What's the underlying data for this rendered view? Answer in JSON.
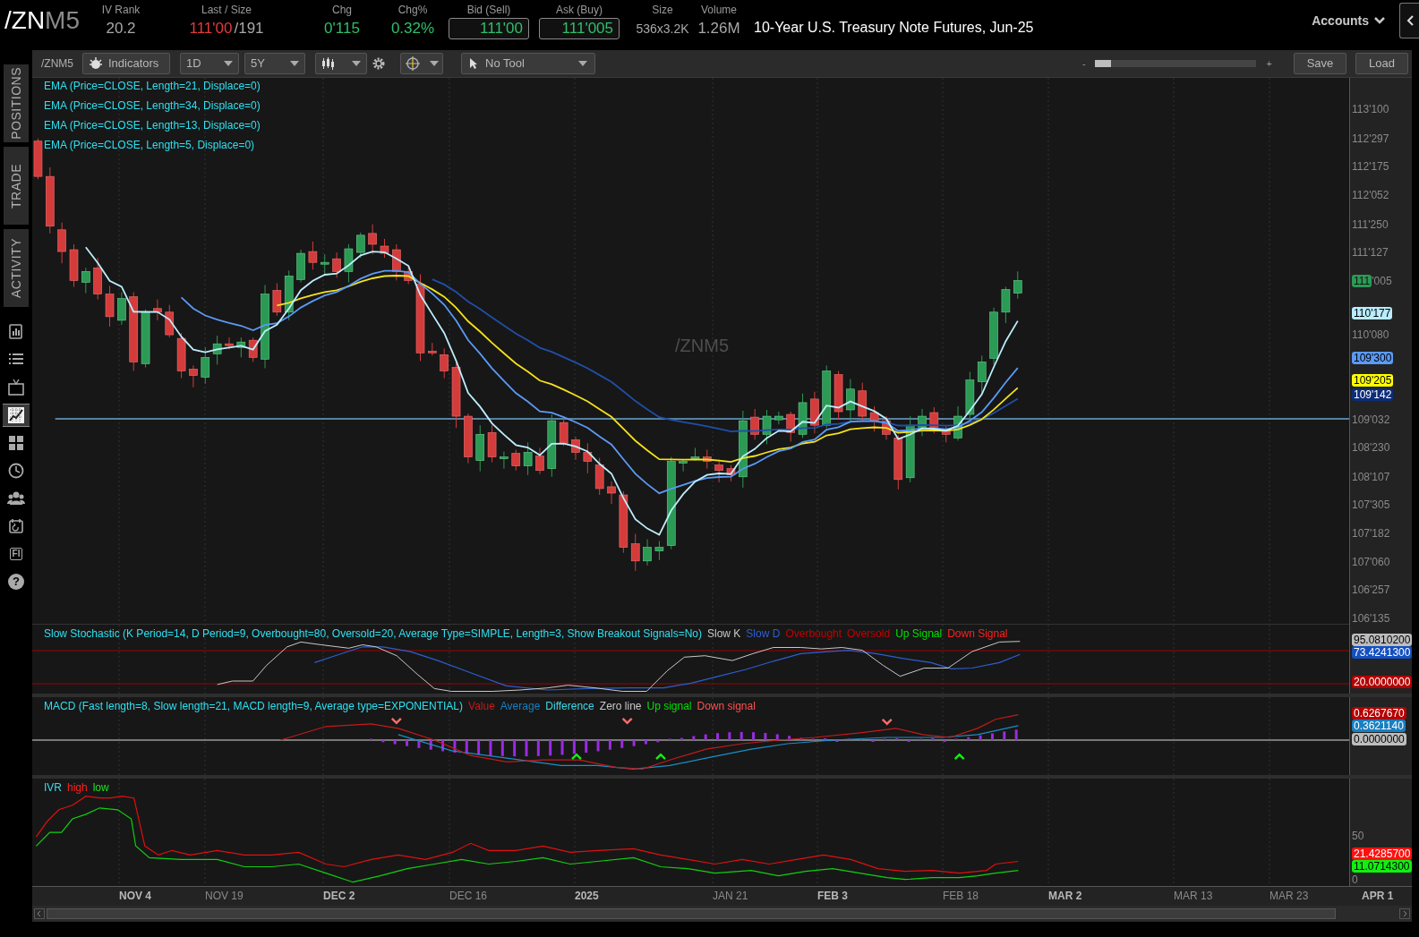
{
  "header": {
    "symbol_root": "/ZN",
    "symbol_suffix": "M5",
    "quotes": [
      {
        "kind": "plain",
        "label": "IV Rank",
        "value": "20.2"
      },
      {
        "kind": "plain",
        "label": "Last / Size",
        "value": "111'00",
        "rising": false,
        "extra": "/191"
      },
      {
        "kind": "plain",
        "label": "Chg",
        "value": "0'115",
        "rising": true
      },
      {
        "kind": "plain",
        "label": "Chg%",
        "value": "0.32%",
        "rising": true
      },
      {
        "kind": "boxed",
        "label": "Bid (Sell)",
        "value": "111'00",
        "rising": true
      },
      {
        "kind": "boxed",
        "label": "Ask (Buy)",
        "value": "111'005",
        "rising": true
      },
      {
        "kind": "small",
        "label": "Size",
        "value": "536x3.2K"
      },
      {
        "kind": "plain",
        "label": "Volume",
        "value": "1.26M"
      }
    ],
    "description": "10-Year U.S. Treasury Note Futures, Jun-25",
    "accounts": "Accounts"
  },
  "sidebar": {
    "tabs": [
      "POSITIONS",
      "TRADE",
      "ACTIVITY"
    ],
    "icons": [
      {
        "kind": "chart-book",
        "selected": false
      },
      {
        "kind": "list",
        "selected": false
      },
      {
        "kind": "tv",
        "selected": false
      },
      {
        "kind": "chart",
        "selected": true
      },
      {
        "kind": "tiles",
        "selected": false
      },
      {
        "kind": "clock",
        "selected": false
      },
      {
        "kind": "people",
        "selected": false
      },
      {
        "kind": "calendar",
        "selected": false
      },
      {
        "kind": "text",
        "label": "FI",
        "selected": false
      },
      {
        "kind": "help",
        "label": "?",
        "selected": false
      }
    ]
  },
  "toolbar": {
    "symbol": "/ZNM5",
    "indicators": "Indicators",
    "dropdowns": [
      "1D",
      "5Y"
    ],
    "drawing_tool": "No Tool",
    "zoom": {
      "minus": "-",
      "plus": "+",
      "level": 0.1
    },
    "buttons": [
      "Save",
      "Load"
    ]
  },
  "price_pane": {
    "studies": [
      "EMA (Price=CLOSE, Length=21, Displace=0)",
      "EMA (Price=CLOSE, Length=34, Displace=0)",
      "EMA (Price=CLOSE, Length=13, Displace=0)",
      "EMA (Price=CLOSE, Length=5, Displace=0)"
    ],
    "watermark": "/ZNM5",
    "ticks": [
      "113'100",
      "112'297",
      "112'175",
      "112'052",
      "111'250",
      "111'127",
      "110'080",
      "109'032",
      "108'230",
      "108'107",
      "107'305",
      "107'182",
      "107'060",
      "106'257",
      "106'135"
    ],
    "last_price": {
      "badge": "111",
      "tick": "'005",
      "color": "#2a9a55"
    },
    "markers": [
      {
        "text": "110'177",
        "color": "#b8ecff"
      },
      {
        "text": "109'300",
        "color": "#5b9af5"
      },
      {
        "text": "109'205",
        "color": "#ffff00"
      },
      {
        "text": "109'142",
        "color": "#0c2d78"
      }
    ]
  },
  "stochastic": {
    "title": "Slow Stochastic (K Period=14, D Period=9, Overbought=80, Oversold=20, Average Type=SIMPLE, Length=3, Show Breakout Signals=No)",
    "legend": [
      {
        "label": "Slow K",
        "color": "#c8c8c8"
      },
      {
        "label": "Slow D",
        "color": "#2c5fd0"
      },
      {
        "label": "Overbought",
        "color": "#c40000"
      },
      {
        "label": "Oversold",
        "color": "#c40000"
      },
      {
        "label": "Up Signal",
        "color": "#00e000"
      },
      {
        "label": "Down Signal",
        "color": "#ff2020"
      }
    ],
    "badges": [
      {
        "text": "95.0810200",
        "color": "#bdbdbd"
      },
      {
        "text": "73.4241300",
        "color": "#1450c0"
      },
      {
        "text": "20.0000000",
        "color": "#b40000"
      }
    ]
  },
  "macd": {
    "title": "MACD (Fast length=8, Slow length=21, MACD length=9, Average type=EXPONENTIAL)",
    "legend": [
      {
        "label": "Value",
        "color": "#c41a1a"
      },
      {
        "label": "Average",
        "color": "#1a7fc0"
      },
      {
        "label": "Difference",
        "color": "#40d8e8"
      },
      {
        "label": "Zero line",
        "color": "#c8c8c8"
      },
      {
        "label": "Up signal",
        "color": "#00e000"
      },
      {
        "label": "Down signal",
        "color": "#ff5050"
      }
    ],
    "badges": [
      {
        "text": "0.6267670",
        "color": "#b40000"
      },
      {
        "text": "0.3621140",
        "color": "#1a7fc0"
      },
      {
        "text": "0.0000000",
        "color": "#bdbdbd"
      }
    ]
  },
  "ivr": {
    "legend": [
      {
        "label": "IVR",
        "color": "#40d8e8"
      },
      {
        "label": "high",
        "color": "#ff2020"
      },
      {
        "label": "low",
        "color": "#20e020"
      }
    ],
    "ticks": [
      "50",
      "0"
    ],
    "badges": [
      {
        "text": "21.4285700",
        "color": "#ff1010"
      },
      {
        "text": "11.0714300",
        "color": "#10f010"
      }
    ]
  },
  "date_axis": [
    {
      "label": "NOV 4",
      "major": true
    },
    {
      "label": "NOV 19",
      "major": false
    },
    {
      "label": "DEC 2",
      "major": true
    },
    {
      "label": "DEC 16",
      "major": false
    },
    {
      "label": "2025",
      "major": true
    },
    {
      "label": "JAN 21",
      "major": false
    },
    {
      "label": "FEB 3",
      "major": true
    },
    {
      "label": "FEB 18",
      "major": false
    },
    {
      "label": "MAR 2",
      "major": true
    },
    {
      "label": "MAR 13",
      "major": false
    },
    {
      "label": "MAR 23",
      "major": false
    },
    {
      "label": "APR 1",
      "major": true
    }
  ]
}
